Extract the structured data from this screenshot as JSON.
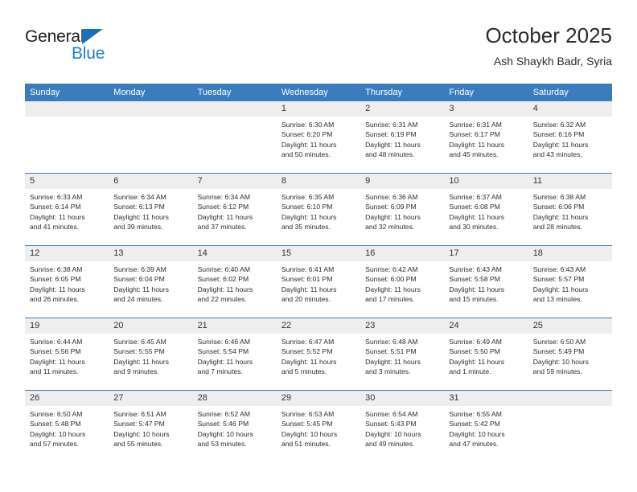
{
  "brand": {
    "name_part1": "General",
    "name_part2": "Blue",
    "accent_color": "#1c7fd4",
    "triangle_color": "#1c6fba"
  },
  "header": {
    "title": "October 2025",
    "subtitle": "Ash Shaykh Badr, Syria"
  },
  "theme": {
    "header_bar_color": "#3a7cbe",
    "daynum_band_color": "#eeeeee",
    "text_color": "#2c2c2c"
  },
  "columns": [
    "Sunday",
    "Monday",
    "Tuesday",
    "Wednesday",
    "Thursday",
    "Friday",
    "Saturday"
  ],
  "weeks": [
    [
      {
        "day": "",
        "empty": true,
        "lines": []
      },
      {
        "day": "",
        "empty": true,
        "lines": []
      },
      {
        "day": "",
        "empty": true,
        "lines": []
      },
      {
        "day": "1",
        "empty": false,
        "lines": [
          "Sunrise: 6:30 AM",
          "Sunset: 6:20 PM",
          "Daylight: 11 hours",
          "and 50 minutes."
        ]
      },
      {
        "day": "2",
        "empty": false,
        "lines": [
          "Sunrise: 6:31 AM",
          "Sunset: 6:19 PM",
          "Daylight: 11 hours",
          "and 48 minutes."
        ]
      },
      {
        "day": "3",
        "empty": false,
        "lines": [
          "Sunrise: 6:31 AM",
          "Sunset: 6:17 PM",
          "Daylight: 11 hours",
          "and 45 minutes."
        ]
      },
      {
        "day": "4",
        "empty": false,
        "lines": [
          "Sunrise: 6:32 AM",
          "Sunset: 6:16 PM",
          "Daylight: 11 hours",
          "and 43 minutes."
        ]
      }
    ],
    [
      {
        "day": "5",
        "empty": false,
        "lines": [
          "Sunrise: 6:33 AM",
          "Sunset: 6:14 PM",
          "Daylight: 11 hours",
          "and 41 minutes."
        ]
      },
      {
        "day": "6",
        "empty": false,
        "lines": [
          "Sunrise: 6:34 AM",
          "Sunset: 6:13 PM",
          "Daylight: 11 hours",
          "and 39 minutes."
        ]
      },
      {
        "day": "7",
        "empty": false,
        "lines": [
          "Sunrise: 6:34 AM",
          "Sunset: 6:12 PM",
          "Daylight: 11 hours",
          "and 37 minutes."
        ]
      },
      {
        "day": "8",
        "empty": false,
        "lines": [
          "Sunrise: 6:35 AM",
          "Sunset: 6:10 PM",
          "Daylight: 11 hours",
          "and 35 minutes."
        ]
      },
      {
        "day": "9",
        "empty": false,
        "lines": [
          "Sunrise: 6:36 AM",
          "Sunset: 6:09 PM",
          "Daylight: 11 hours",
          "and 32 minutes."
        ]
      },
      {
        "day": "10",
        "empty": false,
        "lines": [
          "Sunrise: 6:37 AM",
          "Sunset: 6:08 PM",
          "Daylight: 11 hours",
          "and 30 minutes."
        ]
      },
      {
        "day": "11",
        "empty": false,
        "lines": [
          "Sunrise: 6:38 AM",
          "Sunset: 6:06 PM",
          "Daylight: 11 hours",
          "and 28 minutes."
        ]
      }
    ],
    [
      {
        "day": "12",
        "empty": false,
        "lines": [
          "Sunrise: 6:38 AM",
          "Sunset: 6:05 PM",
          "Daylight: 11 hours",
          "and 26 minutes."
        ]
      },
      {
        "day": "13",
        "empty": false,
        "lines": [
          "Sunrise: 6:39 AM",
          "Sunset: 6:04 PM",
          "Daylight: 11 hours",
          "and 24 minutes."
        ]
      },
      {
        "day": "14",
        "empty": false,
        "lines": [
          "Sunrise: 6:40 AM",
          "Sunset: 6:02 PM",
          "Daylight: 11 hours",
          "and 22 minutes."
        ]
      },
      {
        "day": "15",
        "empty": false,
        "lines": [
          "Sunrise: 6:41 AM",
          "Sunset: 6:01 PM",
          "Daylight: 11 hours",
          "and 20 minutes."
        ]
      },
      {
        "day": "16",
        "empty": false,
        "lines": [
          "Sunrise: 6:42 AM",
          "Sunset: 6:00 PM",
          "Daylight: 11 hours",
          "and 17 minutes."
        ]
      },
      {
        "day": "17",
        "empty": false,
        "lines": [
          "Sunrise: 6:43 AM",
          "Sunset: 5:58 PM",
          "Daylight: 11 hours",
          "and 15 minutes."
        ]
      },
      {
        "day": "18",
        "empty": false,
        "lines": [
          "Sunrise: 6:43 AM",
          "Sunset: 5:57 PM",
          "Daylight: 11 hours",
          "and 13 minutes."
        ]
      }
    ],
    [
      {
        "day": "19",
        "empty": false,
        "lines": [
          "Sunrise: 6:44 AM",
          "Sunset: 5:56 PM",
          "Daylight: 11 hours",
          "and 11 minutes."
        ]
      },
      {
        "day": "20",
        "empty": false,
        "lines": [
          "Sunrise: 6:45 AM",
          "Sunset: 5:55 PM",
          "Daylight: 11 hours",
          "and 9 minutes."
        ]
      },
      {
        "day": "21",
        "empty": false,
        "lines": [
          "Sunrise: 6:46 AM",
          "Sunset: 5:54 PM",
          "Daylight: 11 hours",
          "and 7 minutes."
        ]
      },
      {
        "day": "22",
        "empty": false,
        "lines": [
          "Sunrise: 6:47 AM",
          "Sunset: 5:52 PM",
          "Daylight: 11 hours",
          "and 5 minutes."
        ]
      },
      {
        "day": "23",
        "empty": false,
        "lines": [
          "Sunrise: 6:48 AM",
          "Sunset: 5:51 PM",
          "Daylight: 11 hours",
          "and 3 minutes."
        ]
      },
      {
        "day": "24",
        "empty": false,
        "lines": [
          "Sunrise: 6:49 AM",
          "Sunset: 5:50 PM",
          "Daylight: 11 hours",
          "and 1 minute."
        ]
      },
      {
        "day": "25",
        "empty": false,
        "lines": [
          "Sunrise: 6:50 AM",
          "Sunset: 5:49 PM",
          "Daylight: 10 hours",
          "and 59 minutes."
        ]
      }
    ],
    [
      {
        "day": "26",
        "empty": false,
        "lines": [
          "Sunrise: 6:50 AM",
          "Sunset: 5:48 PM",
          "Daylight: 10 hours",
          "and 57 minutes."
        ]
      },
      {
        "day": "27",
        "empty": false,
        "lines": [
          "Sunrise: 6:51 AM",
          "Sunset: 5:47 PM",
          "Daylight: 10 hours",
          "and 55 minutes."
        ]
      },
      {
        "day": "28",
        "empty": false,
        "lines": [
          "Sunrise: 6:52 AM",
          "Sunset: 5:46 PM",
          "Daylight: 10 hours",
          "and 53 minutes."
        ]
      },
      {
        "day": "29",
        "empty": false,
        "lines": [
          "Sunrise: 6:53 AM",
          "Sunset: 5:45 PM",
          "Daylight: 10 hours",
          "and 51 minutes."
        ]
      },
      {
        "day": "30",
        "empty": false,
        "lines": [
          "Sunrise: 6:54 AM",
          "Sunset: 5:43 PM",
          "Daylight: 10 hours",
          "and 49 minutes."
        ]
      },
      {
        "day": "31",
        "empty": false,
        "lines": [
          "Sunrise: 6:55 AM",
          "Sunset: 5:42 PM",
          "Daylight: 10 hours",
          "and 47 minutes."
        ]
      },
      {
        "day": "",
        "empty": true,
        "lines": []
      }
    ]
  ]
}
